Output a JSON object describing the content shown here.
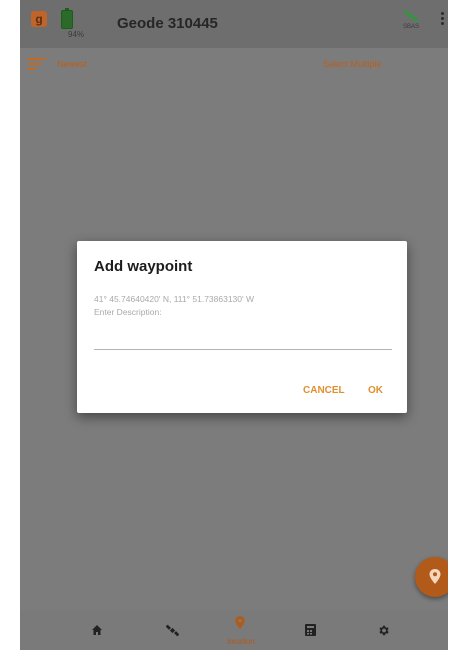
{
  "app": {
    "logo_letter": "g",
    "battery_percent": "94%",
    "title": "Geode 310445",
    "gps_status_label": "SBAS",
    "gps_icon": "satellite-icon",
    "overflow_icon": "more-vert-icon"
  },
  "toolbar": {
    "sort_icon": "sort-icon",
    "sort_label": "Newest",
    "select_multiple_label": "Select Multiple"
  },
  "dialog": {
    "title": "Add waypoint",
    "coordinates": "41° 45.74640420' N, 111° 51.73863130' W",
    "description_hint": "Enter Description:",
    "description_value": "",
    "cancel_label": "CANCEL",
    "ok_label": "OK"
  },
  "fab": {
    "icon": "location-pin-icon"
  },
  "bottom_nav": {
    "items": [
      {
        "icon": "home-icon",
        "label": ""
      },
      {
        "icon": "satellite-icon",
        "label": ""
      },
      {
        "icon": "location-pin-icon",
        "label": "location",
        "active": true
      },
      {
        "icon": "calculator-icon",
        "label": ""
      },
      {
        "icon": "gear-icon",
        "label": ""
      }
    ]
  },
  "colors": {
    "accent": "#e0902f",
    "accent_dark": "#b25a1a",
    "scrim": "#7c7c7c",
    "gps_green": "#2a9a3a"
  }
}
